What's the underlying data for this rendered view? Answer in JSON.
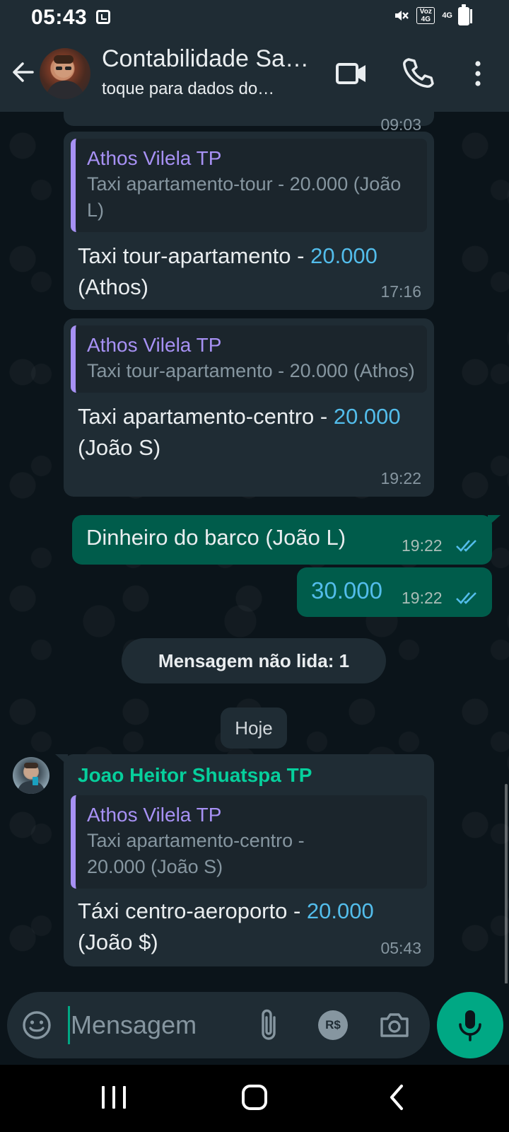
{
  "status_bar": {
    "time": "05:43",
    "volte": "Voz 4G",
    "network": "4G"
  },
  "header": {
    "title": "Contabilidade Sa…",
    "subtitle": "toque para dados do…"
  },
  "messages": [
    {
      "type": "incoming",
      "quote_name": "Athos Vilela TP",
      "quote_text": "Taxi apartamento-tour - 20.000 (João L)",
      "text_before": "Taxi tour-apartamento - ",
      "number": "20.000",
      "text_after": " (Athos)",
      "time": "17:16"
    },
    {
      "type": "incoming",
      "quote_name": "Athos Vilela TP",
      "quote_text": "Taxi tour-apartamento - 20.000 (Athos)",
      "text_before": "Taxi apartamento-centro - ",
      "number": "20.000",
      "text_after": " (João S)",
      "time": "19:22"
    },
    {
      "type": "outgoing",
      "text": "Dinheiro do barco (João L)",
      "time": "19:22",
      "status": "read"
    },
    {
      "type": "outgoing",
      "text": "30.000",
      "time": "19:22",
      "status": "read"
    },
    {
      "type": "incoming",
      "sender": "Joao Heitor Shuatspa TP",
      "quote_name": "Athos Vilela TP",
      "quote_text": "Taxi apartamento-centro - 20.000 (João S)",
      "text_before": "Táxi centro-aeroporto - ",
      "number": "20.000",
      "text_after": " (João $)",
      "time": "05:43"
    }
  ],
  "partial_top_message": {
    "time": "09:03"
  },
  "unread_label": "Mensagem não lida: 1",
  "date_label": "Hoje",
  "composer": {
    "placeholder": "Mensagem",
    "payment_label": "R$"
  },
  "colors": {
    "accent": "#00a884",
    "outgoing_bubble": "#005c4b",
    "incoming_bubble": "#1f2c34",
    "quote_accent": "#a791f4",
    "link_number": "#53bdeb"
  },
  "icons": {
    "back": "arrow-left-icon",
    "video": "video-camera-icon",
    "call": "phone-icon",
    "menu": "more-vertical-icon",
    "emoji": "emoji-icon",
    "attach": "paperclip-icon",
    "payment": "payment-icon",
    "camera": "camera-icon",
    "mic": "microphone-icon"
  }
}
